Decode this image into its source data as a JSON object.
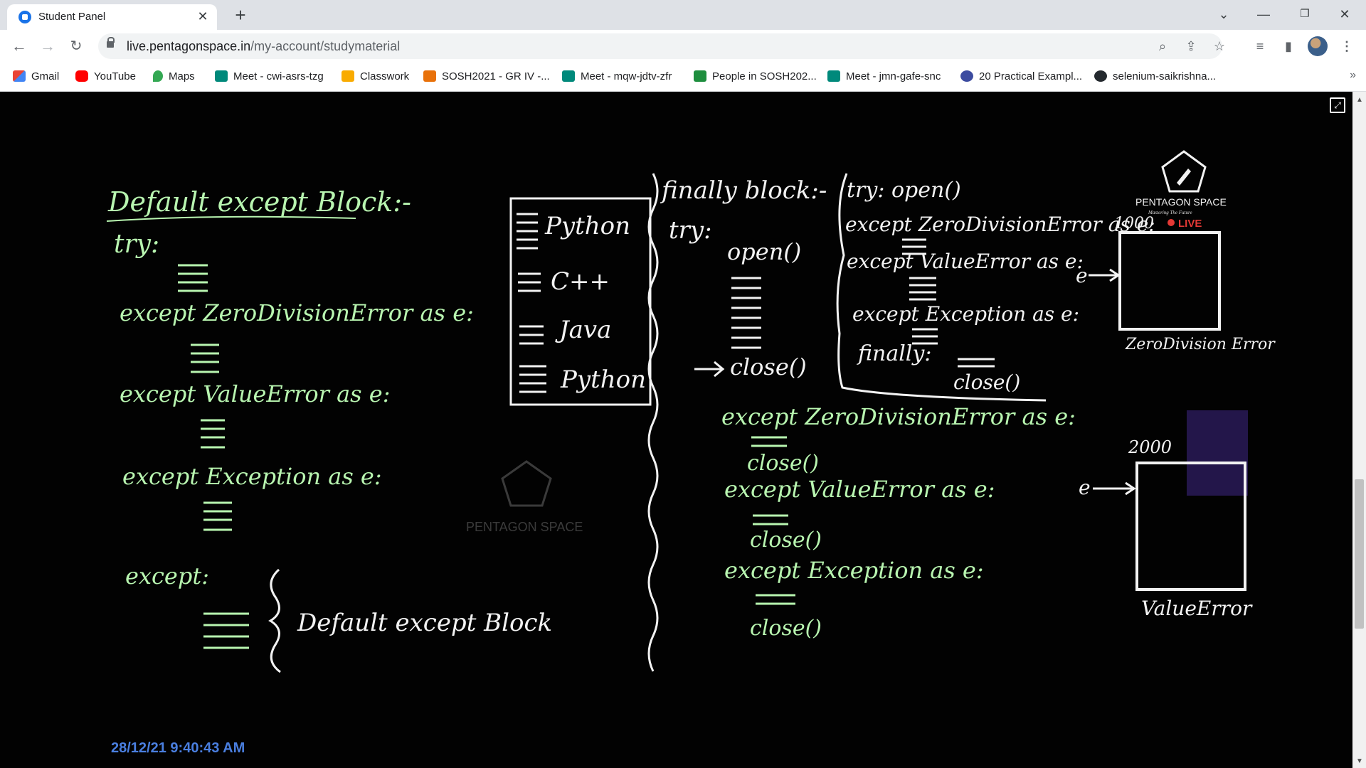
{
  "browser": {
    "tab_title": "Student Panel",
    "url_host": "live.pentagonspace.in",
    "url_path": "/my-account/studymaterial"
  },
  "bookmarks": [
    {
      "label": "Gmail",
      "icon": "gmail-icon",
      "color": "#ea4335"
    },
    {
      "label": "YouTube",
      "icon": "youtube-icon",
      "color": "#ff0000"
    },
    {
      "label": "Maps",
      "icon": "maps-icon",
      "color": "#34a853"
    },
    {
      "label": "Meet - cwi-asrs-tzg",
      "icon": "meet-icon",
      "color": "#00897b"
    },
    {
      "label": "Classwork",
      "icon": "classroom-icon",
      "color": "#f9ab00"
    },
    {
      "label": "SOSH2021 - GR IV -...",
      "icon": "classroom-icon",
      "color": "#e8710a"
    },
    {
      "label": "Meet - mqw-jdtv-zfr",
      "icon": "meet-icon",
      "color": "#00897b"
    },
    {
      "label": "People in SOSH202...",
      "icon": "classroom-icon",
      "color": "#1e8e3e"
    },
    {
      "label": "Meet - jmn-gafe-snc",
      "icon": "meet-icon",
      "color": "#00897b"
    },
    {
      "label": "20 Practical Exampl...",
      "icon": "shield-icon",
      "color": "#3c4ba0"
    },
    {
      "label": "selenium-saikrishna...",
      "icon": "github-icon",
      "color": "#24292e"
    }
  ],
  "board": {
    "left": {
      "heading": "Default except Block:-",
      "try": "try:",
      "except_zero": "except ZeroDivisionError as e:",
      "except_value": "except ValueError as e:",
      "except_exception": "except Exception as e:",
      "except_default": "except:",
      "default_note": "Default except Block"
    },
    "languages": [
      "Python",
      "C++",
      "Java",
      "Python"
    ],
    "right": {
      "heading": "finally block:-",
      "try": "try:",
      "open": "open()",
      "close": "close()",
      "nested_try": "try: open()",
      "nested_except_zero": "except ZeroDivisionError as e:",
      "nested_except_value": "except ValueError as e:",
      "nested_except_exception": "except Exception as e:",
      "nested_finally": "finally:",
      "nested_close": "close()",
      "except_zero": "except ZeroDivisionError as e:",
      "except_value": "except ValueError as e:",
      "except_exception": "except Exception as e:",
      "close_1": "close()",
      "close_2": "close()",
      "close_3": "close()"
    },
    "diagram": {
      "val_top": "1000",
      "box_top_label": "ZeroDivision Error",
      "val_bottom": "2000",
      "box_bottom_label": "ValueError",
      "arrow_e": "e"
    },
    "watermark": "PENTAGON SPACE",
    "brand": "PENTAGON SPACE",
    "brand_tagline": "Mastering The Future",
    "live": "LIVE",
    "timestamp": "28/12/21 9:40:43 AM"
  }
}
